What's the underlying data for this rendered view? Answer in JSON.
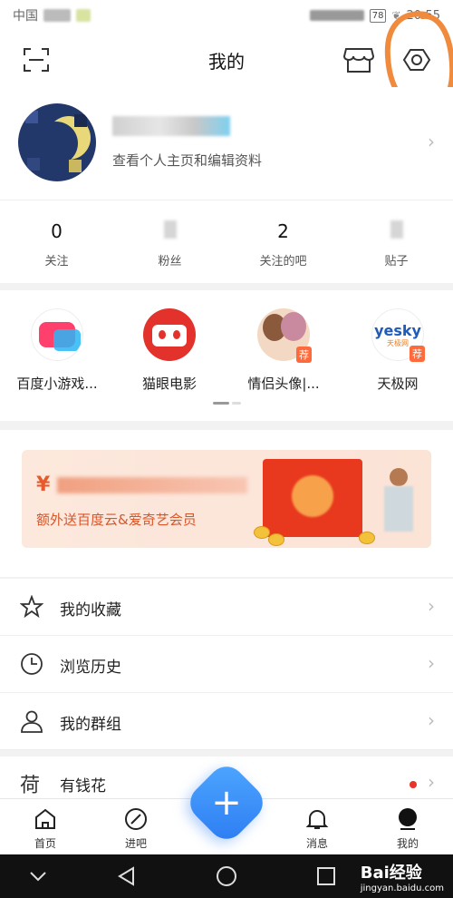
{
  "status_bar": {
    "carrier": "中国",
    "battery": "78",
    "time": "20:55"
  },
  "header": {
    "title": "我的"
  },
  "profile": {
    "hint": "查看个人主页和编辑资料"
  },
  "stats": [
    {
      "value": "0",
      "label": "关注"
    },
    {
      "value": "",
      "label": "粉丝"
    },
    {
      "value": "2",
      "label": "关注的吧"
    },
    {
      "value": "",
      "label": "贴子"
    }
  ],
  "apps": [
    {
      "label": "百度小游戏...",
      "tag": ""
    },
    {
      "label": "猫眼电影",
      "tag": ""
    },
    {
      "label": "情侣头像|...",
      "tag": "荐"
    },
    {
      "label": "天极网",
      "tag": "荐",
      "logo": "yesky",
      "logo_sub": "天极网"
    }
  ],
  "banner": {
    "currency": "¥",
    "subtitle": "额外送百度云&爱奇艺会员"
  },
  "menu": [
    {
      "icon": "star-icon",
      "label": "我的收藏"
    },
    {
      "icon": "clock-icon",
      "label": "浏览历史"
    },
    {
      "icon": "person-icon",
      "label": "我的群组"
    },
    {
      "icon": "money-icon",
      "icon_text": "荷",
      "label": "有钱花"
    }
  ],
  "tabs": [
    {
      "label": "首页"
    },
    {
      "label": "进吧"
    },
    {
      "label": "消息"
    },
    {
      "label": "我的"
    }
  ],
  "fab": {
    "symbol": "+"
  },
  "watermark": {
    "brand": "Bai经验",
    "url": "jingyan.baidu.com"
  },
  "colors": {
    "accent": "#2c7bf2",
    "annotation": "#f08a3c",
    "badge": "#e8342a",
    "brand_red": "#e8391f"
  }
}
